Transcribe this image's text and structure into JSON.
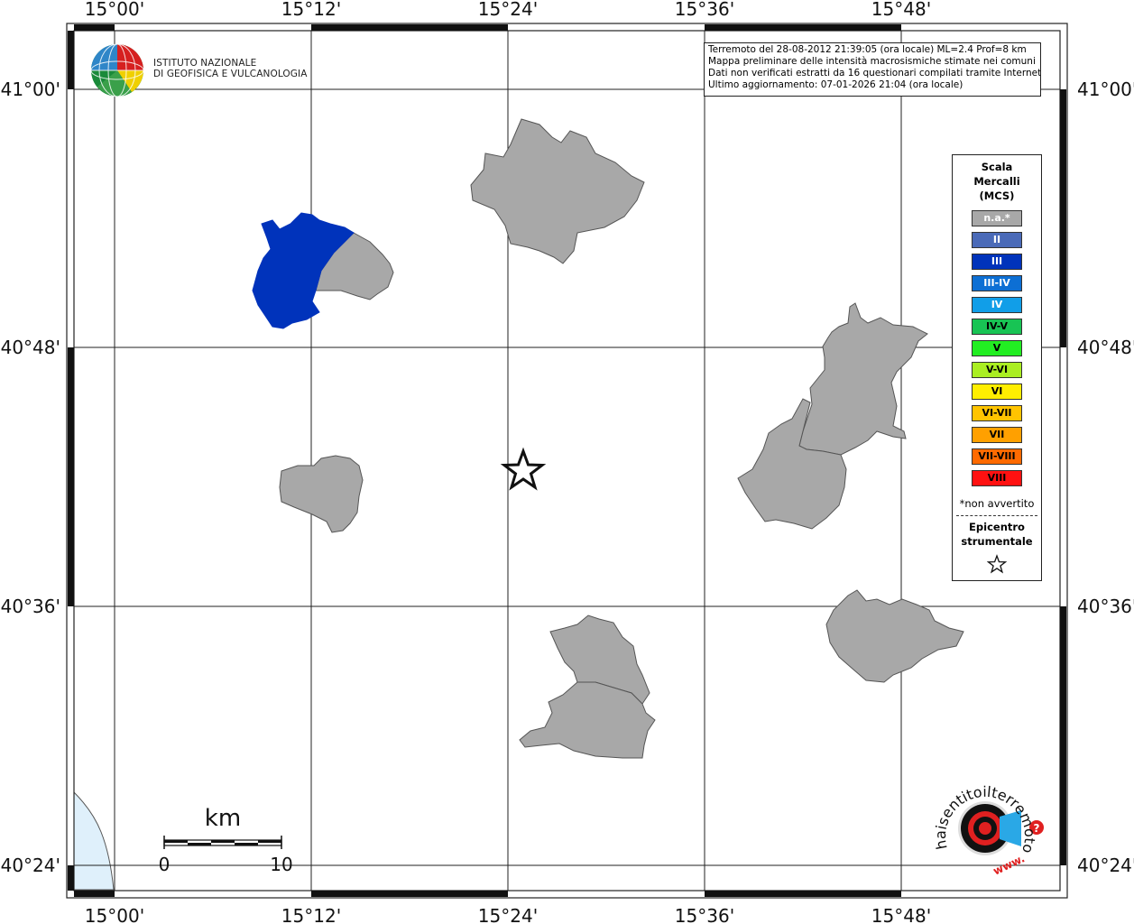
{
  "logo": {
    "line1": "ISTITUTO NAZIONALE",
    "line2": "DI GEOFISICA E VULCANOLOGIA"
  },
  "info": {
    "line1": "Terremoto del 28-08-2012 21:39:05 (ora locale) ML=2.4 Prof=8 km",
    "line2": "Mappa preliminare delle intensità macrosismiche stimate nei comuni",
    "line3": "Dati non verificati estratti da 16 questionari compilati tramite Internet.",
    "line4": "Ultimo aggiornamento: 07-01-2026 21:04 (ora locale)"
  },
  "axes": {
    "lon_ticks": [
      "15°00'",
      "15°12'",
      "15°24'",
      "15°36'",
      "15°48'"
    ],
    "lat_ticks": [
      "41°00'",
      "40°48'",
      "40°36'",
      "40°24'"
    ]
  },
  "scalebar": {
    "unit": "km",
    "min_label": "0",
    "max_label": "10"
  },
  "legend": {
    "title_line1": "Scala",
    "title_line2": "Mercalli",
    "title_line3": "(MCS)",
    "items": [
      {
        "label": "n.a.*",
        "color": "#a8a8a8",
        "text_color": "#ffffff"
      },
      {
        "label": "II",
        "color": "#4a6ab8",
        "text_color": "#ffffff"
      },
      {
        "label": "III",
        "color": "#0033bb",
        "text_color": "#ffffff"
      },
      {
        "label": "III-IV",
        "color": "#0d6fd4",
        "text_color": "#ffffff"
      },
      {
        "label": "IV",
        "color": "#119ee8",
        "text_color": "#ffffff"
      },
      {
        "label": "IV-V",
        "color": "#18c454",
        "text_color": "#000000"
      },
      {
        "label": "V",
        "color": "#22ee22",
        "text_color": "#000000"
      },
      {
        "label": "V-VI",
        "color": "#aaee22",
        "text_color": "#000000"
      },
      {
        "label": "VI",
        "color": "#ffee00",
        "text_color": "#000000"
      },
      {
        "label": "VI-VII",
        "color": "#ffc400",
        "text_color": "#000000"
      },
      {
        "label": "VII",
        "color": "#ffa000",
        "text_color": "#000000"
      },
      {
        "label": "VII-VIII",
        "color": "#ff6a00",
        "text_color": "#000000"
      },
      {
        "label": "VIII",
        "color": "#ff1111",
        "text_color": "#000000"
      }
    ],
    "note": "*non avvertito",
    "epicenter_line1": "Epicentro",
    "epicenter_line2": "strumentale"
  },
  "colors": {
    "not_felt": "#a8a8a8",
    "intensity_III": "#0033bb",
    "sea": "#dff0fb"
  },
  "watermark": {
    "text": "haisentitoilterremoto.it",
    "url": "www.",
    "badge": "?"
  }
}
